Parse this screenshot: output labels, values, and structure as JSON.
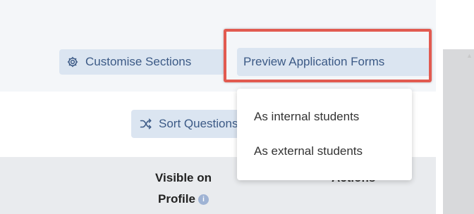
{
  "toolbar": {
    "customise_label": "Customise Sections",
    "preview_label": "Preview Application Forms",
    "sort_label": "Sort Questions"
  },
  "dropdown": {
    "items": [
      "As internal students",
      "As external students"
    ]
  },
  "table": {
    "visible_header_line1": "Visible on",
    "visible_header_line2": "Profile",
    "actions_header": "Actions",
    "info_glyph": "i"
  },
  "colors": {
    "button_bg": "#dbe5f1",
    "button_text": "#3c5a86",
    "highlight_border": "#e25a50"
  },
  "icons": {
    "customise": "gear-icon",
    "sort": "shuffle-icon",
    "info": "info-icon",
    "scroll": "scroll-up-arrow-icon"
  }
}
